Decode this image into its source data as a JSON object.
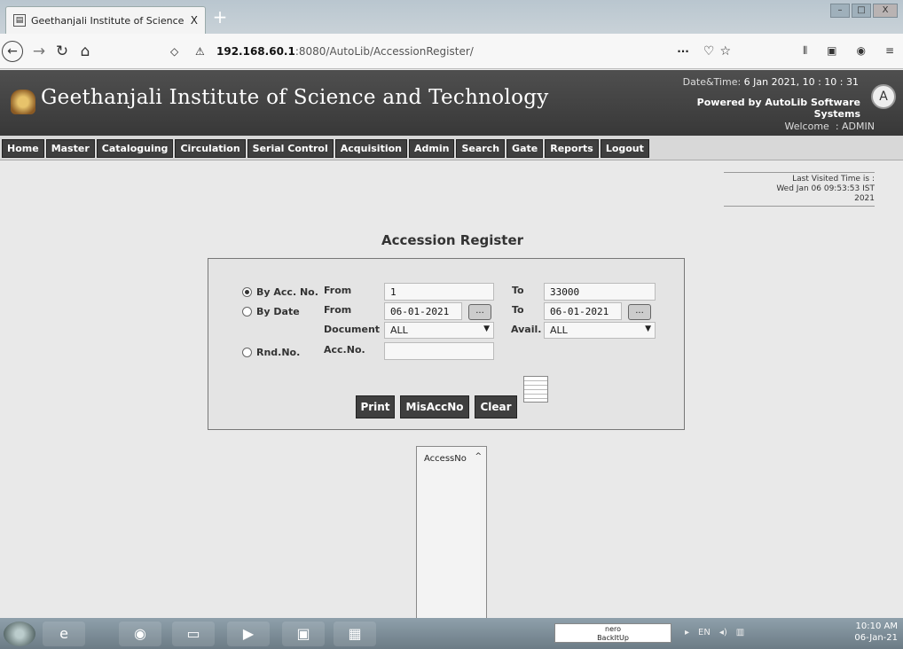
{
  "browser": {
    "tab_title": "Geethanjali Institute of Science",
    "tab_close": "X",
    "new_tab": "+",
    "url_host": "192.168.60.1",
    "url_path": ":8080/AutoLib/AccessionRegister/",
    "url_more": "···",
    "window_controls": [
      "–",
      "□",
      "X"
    ]
  },
  "header": {
    "site_title": "Geethanjali Institute of Science and Technology",
    "datetime_label": "Date&Time:",
    "datetime_value": "6 Jan 2021, 10 : 10 : 31",
    "powered_line1": "Powered by AutoLib Software",
    "powered_line2": "Systems",
    "welcome_label": "Welcome",
    "welcome_sep": ":",
    "welcome_user": "ADMIN"
  },
  "menu": [
    "Home",
    "Master",
    "Cataloguing",
    "Circulation",
    "Serial Control",
    "Acquisition",
    "Admin",
    "Search",
    "Gate",
    "Reports",
    "Logout"
  ],
  "last_visited": {
    "label": "Last Visited Time is :",
    "value_line1": "Wed Jan 06 09:53:53 IST",
    "value_line2": "2021"
  },
  "page_title": "Accession Register",
  "form": {
    "by_acc_label": "By Acc. No.",
    "by_date_label": "By Date",
    "rnd_label": "Rnd.No.",
    "from_label": "From",
    "to_label": "To",
    "document_label": "Document",
    "avail_label": "Avail.",
    "accno_label": "Acc.No.",
    "acc_from_value": "1",
    "acc_to_value": "33000",
    "date_from_value": "06-01-2021",
    "date_to_value": "06-01-2021",
    "calendar_btn": "...",
    "document_value": "ALL",
    "avail_value": "ALL",
    "rnd_accno_value": "",
    "print_label": "Print",
    "misaccno_label": "MisAccNo",
    "clear_label": "Clear"
  },
  "result_list": {
    "header": "AccessNo",
    "sort_glyph": "^"
  },
  "taskbar": {
    "nero_line1": "nero",
    "nero_line2": "BackItUp",
    "tray_lang": "EN",
    "clock_time": "10:10 AM",
    "clock_date": "06-Jan-21"
  }
}
